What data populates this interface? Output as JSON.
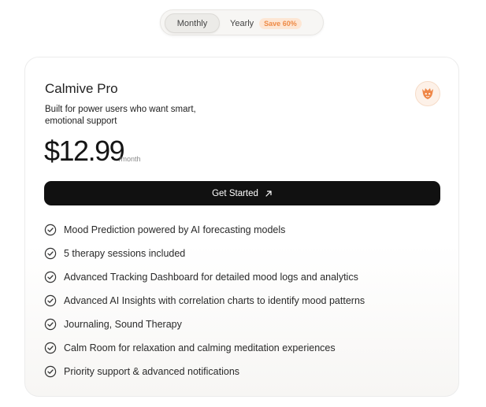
{
  "billing_toggle": {
    "monthly_label": "Monthly",
    "yearly_label": "Yearly",
    "save_badge": "Save 60%",
    "selected": "Monthly"
  },
  "plan": {
    "name": "Calmive Pro",
    "description": "Built for power users who want smart, emotional support",
    "price": "$12.99",
    "price_unit": "/month",
    "cta_label": "Get Started",
    "cta_icon": "arrow-up-right-icon",
    "logo_icon": "calmive-logo-icon",
    "features": [
      "Mood Prediction powered by AI forecasting models",
      "5 therapy sessions included",
      "Advanced Tracking Dashboard for detailed mood logs and analytics",
      "Advanced AI Insights with correlation charts to identify mood patterns",
      "Journaling, Sound Therapy",
      "Calm Room for relaxation and calming meditation experiences",
      "Priority support & advanced notifications"
    ],
    "feature_icon": "check-circle-icon"
  },
  "colors": {
    "accent": "#ee8a45",
    "badge_bg": "#fde6d4",
    "cta_bg": "#111111"
  }
}
